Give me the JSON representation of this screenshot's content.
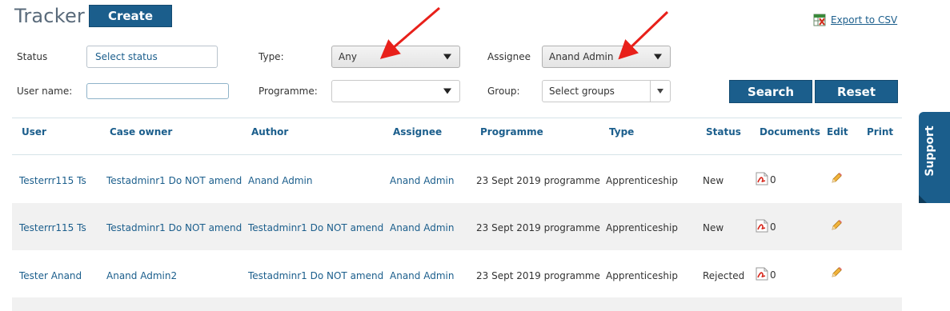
{
  "header": {
    "title": "Tracker",
    "create_label": "Create",
    "export_label": "Export to CSV"
  },
  "filters": {
    "status_label": "Status",
    "status_placeholder": "Select status",
    "type_label": "Type:",
    "type_value": "Any",
    "assignee_label": "Assignee",
    "assignee_value": "Anand Admin",
    "username_label": "User name:",
    "username_value": "",
    "programme_label": "Programme:",
    "programme_value": "",
    "group_label": "Group:",
    "group_placeholder": "Select groups",
    "search_label": "Search",
    "reset_label": "Reset"
  },
  "table": {
    "columns": [
      "User",
      "Case owner",
      "Author",
      "Assignee",
      "Programme",
      "Type",
      "Status",
      "Documents",
      "Edit",
      "Print"
    ],
    "rows": [
      {
        "user": "Testerrr115 Ts",
        "case_owner": "Testadminr1 Do NOT amend",
        "author": "Anand Admin",
        "assignee": "Anand Admin",
        "programme": "23 Sept 2019 programme",
        "type": "Apprenticeship",
        "status": "New",
        "documents": "0"
      },
      {
        "user": "Testerrr115 Ts",
        "case_owner": "Testadminr1 Do NOT amend",
        "author": "Testadminr1 Do NOT amend",
        "assignee": "Anand Admin",
        "programme": "23 Sept 2019 programme",
        "type": "Apprenticeship",
        "status": "New",
        "documents": "0"
      },
      {
        "user": "Tester Anand",
        "case_owner": "Anand Admin2",
        "author": "Testadminr1 Do NOT amend",
        "assignee": "Anand Admin",
        "programme": "23 Sept 2019 programme",
        "type": "Apprenticeship",
        "status": "Rejected",
        "documents": "0"
      }
    ]
  },
  "support": {
    "label": "Support"
  },
  "colors": {
    "accent": "#1b5e8c",
    "annotation_arrow": "#e8201a",
    "row_alt": "#f1f1f1"
  },
  "icons": {
    "export": "spreadsheet-icon",
    "documents": "pdf-icon",
    "edit": "pencil-icon"
  }
}
